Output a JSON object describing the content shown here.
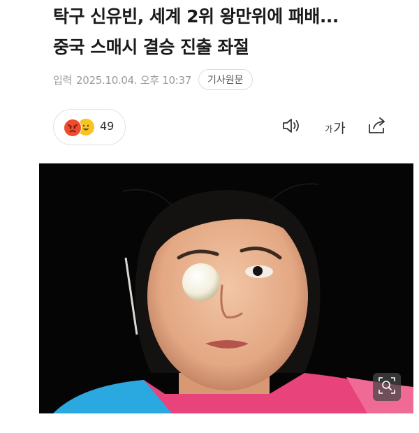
{
  "article": {
    "headline_line1": "탁구 신유빈, 세계 2위 왕만위에 패배...",
    "headline_line2": "중국 스매시 결승 진출 좌절",
    "published_label": "입력",
    "published_at": "2025.10.04. 오후 10:37",
    "source_button": "기사원문"
  },
  "reactions": {
    "count": "49",
    "icons": [
      "angry-face-icon",
      "smiling-face-icon"
    ]
  },
  "toolbar": {
    "font_small": "가",
    "font_large": "가",
    "icons": [
      "speaker-icon",
      "font-size-icon",
      "share-icon"
    ]
  },
  "photo": {
    "zoom_icon": "magnifier-icon"
  },
  "colors": {
    "photo_background": "#050505",
    "jersey_pink": "#e8437a",
    "jersey_blue": "#2aa8e0",
    "reaction_angry": "#ef4b2f",
    "reaction_smile": "#f7c325"
  }
}
